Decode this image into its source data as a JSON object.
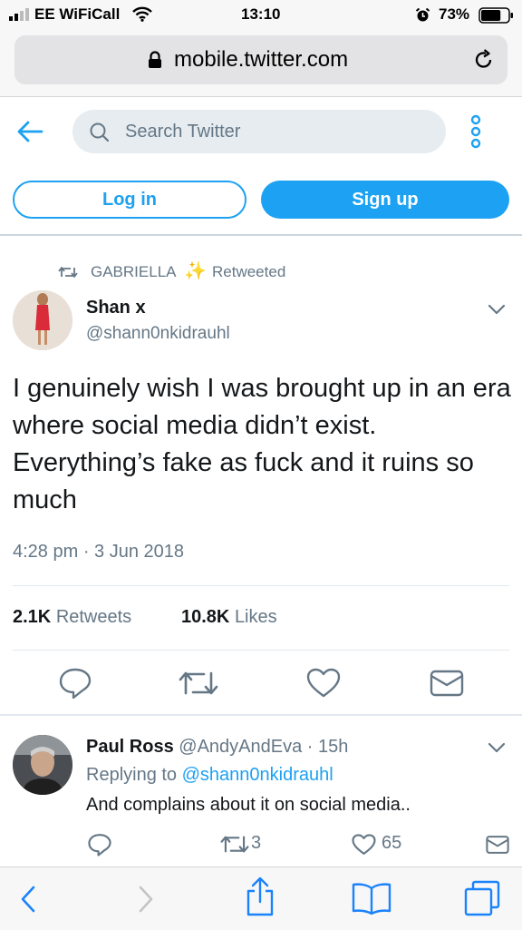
{
  "status_bar": {
    "carrier": "EE WiFiCall",
    "time": "13:10",
    "battery": "73%",
    "battery_level": 0.73
  },
  "browser": {
    "url": "mobile.twitter.com"
  },
  "header": {
    "search_placeholder": "Search Twitter",
    "login_label": "Log in",
    "signup_label": "Sign up"
  },
  "tweet": {
    "retweeted_by": "GABRIELLA",
    "retweeted_emoji": "✨",
    "retweeted_label": "Retweeted",
    "author_name": "Shan x",
    "author_handle": "@shann0nkidrauhl",
    "text": "I genuinely wish I was brought up in an era where social media didn’t exist. Everything’s fake as fuck and it ruins so much",
    "timestamp": "4:28 pm · 3 Jun 2018",
    "retweets_count": "2.1K",
    "retweets_label": "Retweets",
    "likes_count": "10.8K",
    "likes_label": "Likes"
  },
  "reply": {
    "author_name": "Paul Ross",
    "author_handle": "@AndyAndEva",
    "time": "· 15h",
    "replying_prefix": "Replying to",
    "replying_to": "@shann0nkidrauhl",
    "text": "And complains about it on social media..",
    "retweet_count": "3",
    "like_count": "65"
  },
  "colors": {
    "twitter_blue": "#1da1f2",
    "muted": "#657786"
  },
  "icons": [
    "signal-icon",
    "wifi-icon",
    "alarm-icon",
    "battery-icon",
    "lock-icon",
    "reload-icon",
    "back-arrow-icon",
    "search-icon",
    "more-icon",
    "retweet-icon",
    "chevron-down-icon",
    "reply-icon",
    "heart-icon",
    "mail-icon",
    "share-icon",
    "bookmarks-icon",
    "tabs-icon"
  ]
}
